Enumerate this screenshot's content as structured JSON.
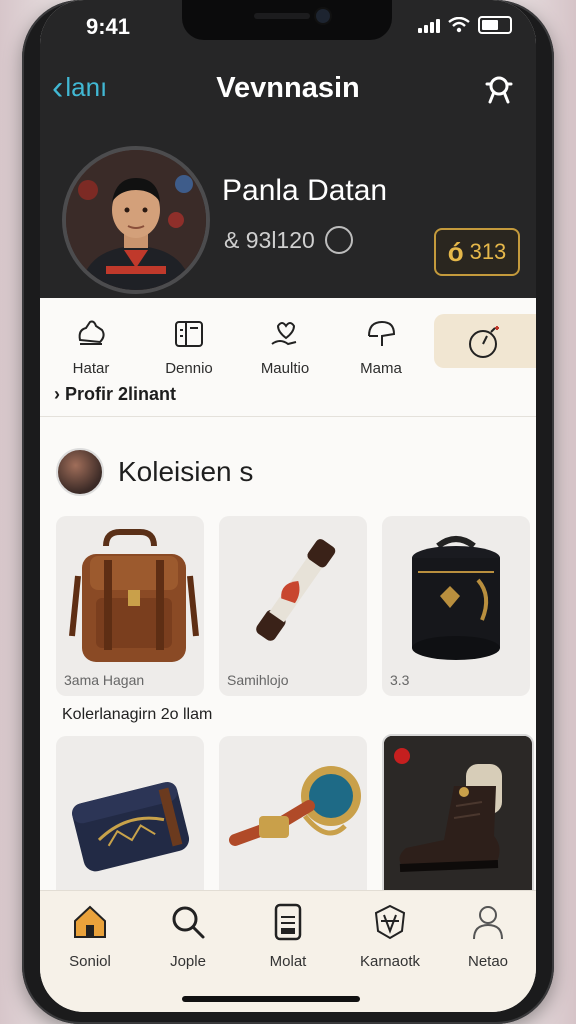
{
  "status": {
    "time": "9:41"
  },
  "nav": {
    "back_label": "lanı",
    "title": "Vevnnasin"
  },
  "profile": {
    "name": "Panla Datan",
    "meta": "& 93l120",
    "coins": "313"
  },
  "tabs": [
    {
      "label": "Hatar",
      "icon": "hand-icon"
    },
    {
      "label": "Dennio",
      "icon": "card-icon"
    },
    {
      "label": "Maultio",
      "icon": "hand-heart-icon"
    },
    {
      "label": "Mama",
      "icon": "helmet-icon"
    },
    {
      "label": "",
      "icon": "compass-icon",
      "active": true
    }
  ],
  "breadcrumb": "Profir  2linant",
  "collection": {
    "title": "Koleisien s",
    "subheading": "Kolerlanagirn 2o llam",
    "items": [
      {
        "caption": "3ama Hagan",
        "icon": "backpack-icon"
      },
      {
        "caption": "Samihlojo",
        "icon": "baton-icon"
      },
      {
        "caption": "3.3",
        "icon": "drum-icon"
      },
      {
        "caption": "",
        "icon": "case-icon"
      },
      {
        "caption": "",
        "icon": "trumpet-icon"
      },
      {
        "caption": "",
        "icon": "boot-icon"
      }
    ]
  },
  "tabbar": [
    {
      "label": "Soniol",
      "icon": "home-icon"
    },
    {
      "label": "Jople",
      "icon": "search-icon"
    },
    {
      "label": "Molat",
      "icon": "phone-doc-icon"
    },
    {
      "label": "Karnaotk",
      "icon": "emblem-icon"
    },
    {
      "label": "Netao",
      "icon": "person-icon"
    }
  ],
  "colors": {
    "accent_cyan": "#41b8d4",
    "gold": "#e6b84a",
    "dark_header": "#262627",
    "home_icon": "#e9a23b"
  }
}
